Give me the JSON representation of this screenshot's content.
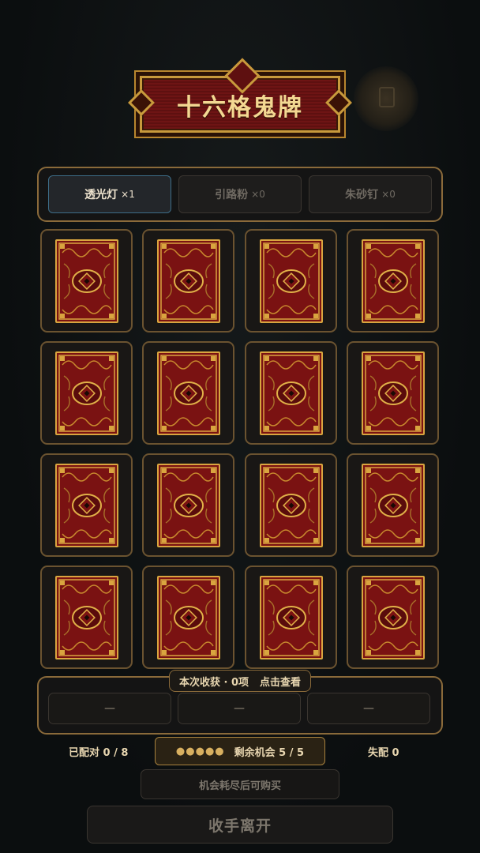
{
  "title": "十六格鬼牌",
  "tools": [
    {
      "name": "透光灯",
      "count": "×1",
      "active": true
    },
    {
      "name": "引路粉",
      "count": "×0",
      "active": false
    },
    {
      "name": "朱砂钉",
      "count": "×0",
      "active": false
    }
  ],
  "cards": {
    "rows": 4,
    "cols": 4,
    "state": "face-down"
  },
  "loot": {
    "summary": "本次收获 · 0项",
    "view_label": "点击查看",
    "slots": [
      "—",
      "—",
      "—"
    ]
  },
  "status": {
    "matched": "已配对 0 / 8",
    "dots": "●●●●●",
    "remaining": "剩余机会 5 / 5",
    "mismatch": "失配 0"
  },
  "buy_label": "机会耗尽后可购买",
  "leave_label": "收手离开",
  "colors": {
    "accent_gold": "#c89a3c",
    "card_red": "#7a1212",
    "active_border": "#3d6d88"
  }
}
